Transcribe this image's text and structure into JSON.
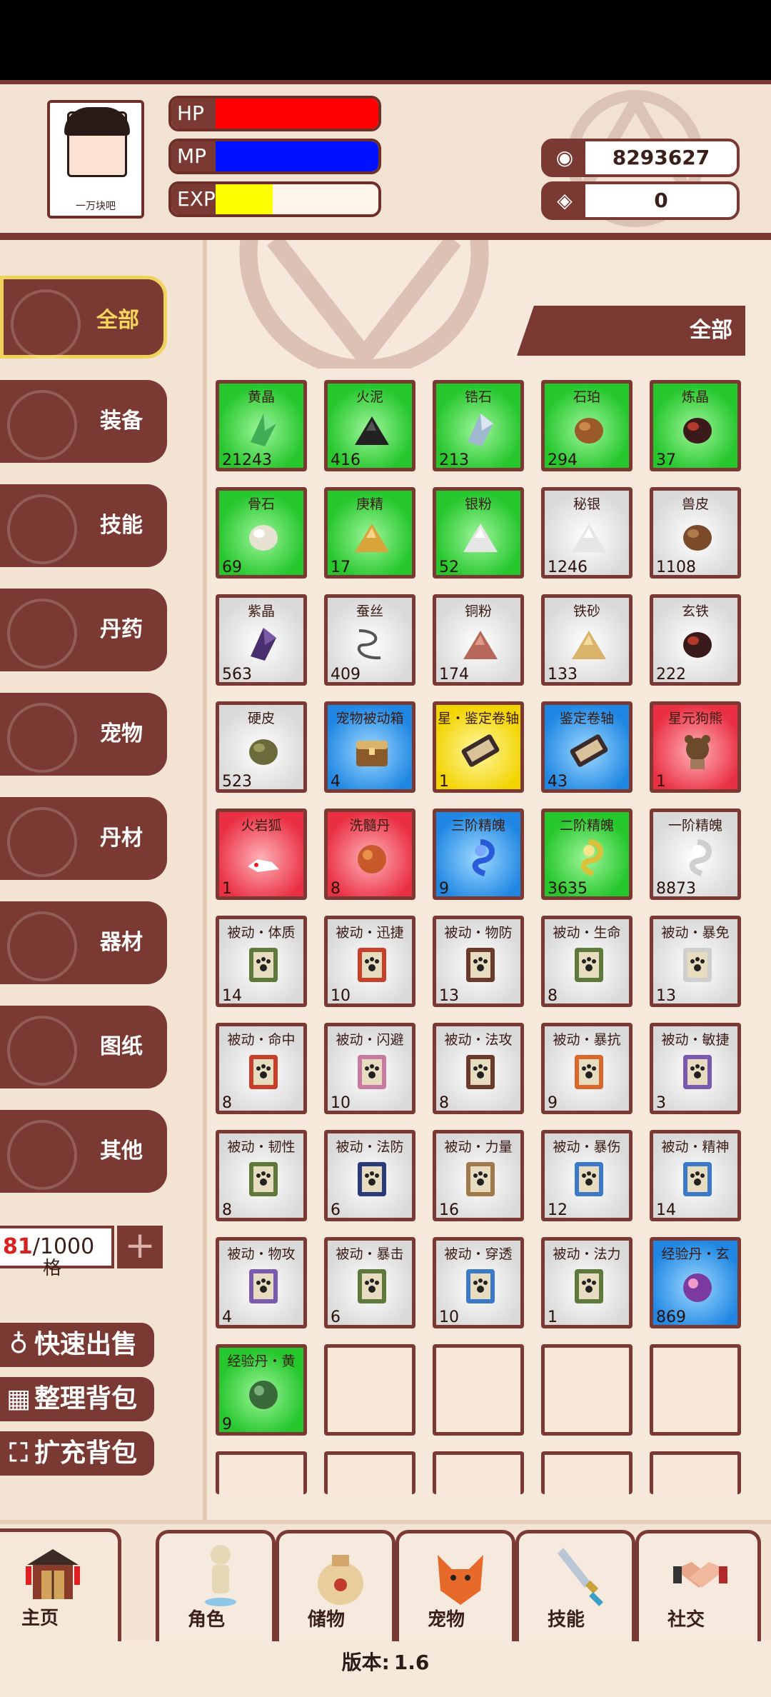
{
  "player": {
    "name": "一万块吧"
  },
  "stats": {
    "hp_label": "HP",
    "hp_fraction": 1.0,
    "mp_label": "MP",
    "mp_fraction": 1.0,
    "exp_label": "EXP",
    "exp_fraction": 0.35
  },
  "currency": {
    "coins": "8293627",
    "gems": "0",
    "coin_icon": "coin-icon",
    "gem_icon": "gem-icon"
  },
  "categories": [
    {
      "label": "全部",
      "active": true
    },
    {
      "label": "装备"
    },
    {
      "label": "技能"
    },
    {
      "label": "丹药"
    },
    {
      "label": "宠物"
    },
    {
      "label": "丹材"
    },
    {
      "label": "器材"
    },
    {
      "label": "图纸"
    },
    {
      "label": "其他"
    }
  ],
  "capacity": {
    "used": "81",
    "total": "/1000",
    "unit": "格"
  },
  "actions": {
    "quick_sell": "快速出售",
    "sort_bag": "整理背包",
    "expand_bag": "扩充背包"
  },
  "filter": {
    "label": "全部"
  },
  "items": [
    {
      "name": "黄晶",
      "count": "21243",
      "rarity": "green",
      "art": "crystal"
    },
    {
      "name": "火泥",
      "count": "416",
      "rarity": "green",
      "art": "pile-dark"
    },
    {
      "name": "锆石",
      "count": "213",
      "rarity": "green",
      "art": "crystal-blue"
    },
    {
      "name": "石珀",
      "count": "294",
      "rarity": "green",
      "art": "stone"
    },
    {
      "name": "炼晶",
      "count": "37",
      "rarity": "green",
      "art": "ore-red"
    },
    {
      "name": "骨石",
      "count": "69",
      "rarity": "green",
      "art": "bone"
    },
    {
      "name": "庚精",
      "count": "17",
      "rarity": "green",
      "art": "pile-gold"
    },
    {
      "name": "银粉",
      "count": "52",
      "rarity": "green",
      "art": "pile-white"
    },
    {
      "name": "秘银",
      "count": "1246",
      "rarity": "white",
      "art": "pile-white"
    },
    {
      "name": "兽皮",
      "count": "1108",
      "rarity": "white",
      "art": "hide"
    },
    {
      "name": "紫晶",
      "count": "563",
      "rarity": "white",
      "art": "crystal-purple"
    },
    {
      "name": "蚕丝",
      "count": "409",
      "rarity": "white",
      "art": "thread"
    },
    {
      "name": "铜粉",
      "count": "174",
      "rarity": "white",
      "art": "pile-copper"
    },
    {
      "name": "铁砂",
      "count": "133",
      "rarity": "white",
      "art": "grains"
    },
    {
      "name": "玄铁",
      "count": "222",
      "rarity": "white",
      "art": "ore-red"
    },
    {
      "name": "硬皮",
      "count": "523",
      "rarity": "white",
      "art": "leather"
    },
    {
      "name": "宠物被动箱",
      "count": "4",
      "rarity": "blue",
      "art": "chest"
    },
    {
      "name": "星・鉴定卷轴",
      "count": "1",
      "rarity": "yellow",
      "art": "scroll-dark"
    },
    {
      "name": "鉴定卷轴",
      "count": "43",
      "rarity": "blue",
      "art": "scroll-dark"
    },
    {
      "name": "星元狗熊",
      "count": "1",
      "rarity": "red",
      "art": "bear"
    },
    {
      "name": "火岩狐",
      "count": "1",
      "rarity": "red",
      "art": "fox"
    },
    {
      "name": "洗髓丹",
      "count": "8",
      "rarity": "red",
      "art": "pill-orange"
    },
    {
      "name": "三阶精魄",
      "count": "9",
      "rarity": "blue",
      "art": "spirit-blue"
    },
    {
      "name": "二阶精魄",
      "count": "3635",
      "rarity": "green",
      "art": "spirit-green"
    },
    {
      "name": "一阶精魄",
      "count": "8873",
      "rarity": "white",
      "art": "spirit-white"
    },
    {
      "name": "被动・体质",
      "count": "14",
      "rarity": "white",
      "art": "paw-green"
    },
    {
      "name": "被动・迅捷",
      "count": "10",
      "rarity": "white",
      "art": "paw-red"
    },
    {
      "name": "被动・物防",
      "count": "13",
      "rarity": "white",
      "art": "paw-brown"
    },
    {
      "name": "被动・生命",
      "count": "8",
      "rarity": "white",
      "art": "paw-green"
    },
    {
      "name": "被动・暴免",
      "count": "13",
      "rarity": "white",
      "art": "paw-white"
    },
    {
      "name": "被动・命中",
      "count": "8",
      "rarity": "white",
      "art": "paw-red"
    },
    {
      "name": "被动・闪避",
      "count": "10",
      "rarity": "white",
      "art": "paw-pink"
    },
    {
      "name": "被动・法攻",
      "count": "8",
      "rarity": "white",
      "art": "paw-brown"
    },
    {
      "name": "被动・暴抗",
      "count": "9",
      "rarity": "white",
      "art": "paw-orange"
    },
    {
      "name": "被动・敏捷",
      "count": "3",
      "rarity": "white",
      "art": "paw-purple"
    },
    {
      "name": "被动・韧性",
      "count": "8",
      "rarity": "white",
      "art": "paw-green"
    },
    {
      "name": "被动・法防",
      "count": "6",
      "rarity": "white",
      "art": "paw-navy"
    },
    {
      "name": "被动・力量",
      "count": "16",
      "rarity": "white",
      "art": "paw-tan"
    },
    {
      "name": "被动・暴伤",
      "count": "12",
      "rarity": "white",
      "art": "paw-blue"
    },
    {
      "name": "被动・精神",
      "count": "14",
      "rarity": "white",
      "art": "paw-blue"
    },
    {
      "name": "被动・物攻",
      "count": "4",
      "rarity": "white",
      "art": "paw-purple"
    },
    {
      "name": "被动・暴击",
      "count": "6",
      "rarity": "white",
      "art": "paw-green"
    },
    {
      "name": "被动・穿透",
      "count": "10",
      "rarity": "white",
      "art": "paw-blue"
    },
    {
      "name": "被动・法力",
      "count": "1",
      "rarity": "white",
      "art": "paw-green"
    },
    {
      "name": "经验丹・玄",
      "count": "869",
      "rarity": "blue",
      "art": "pill-purple"
    },
    {
      "name": "经验丹・黄",
      "count": "9",
      "rarity": "green",
      "art": "pill-green"
    }
  ],
  "empty_slots": 4,
  "partial_row_slots": 5,
  "nav": [
    {
      "label": "主页",
      "icon": "house-icon"
    },
    {
      "label": "角色",
      "icon": "figure-icon"
    },
    {
      "label": "储物",
      "icon": "bag-icon"
    },
    {
      "label": "宠物",
      "icon": "fox-icon"
    },
    {
      "label": "技能",
      "icon": "sword-icon"
    },
    {
      "label": "社交",
      "icon": "handshake-icon"
    }
  ],
  "version": {
    "label": "版本:",
    "number": "1.6"
  }
}
